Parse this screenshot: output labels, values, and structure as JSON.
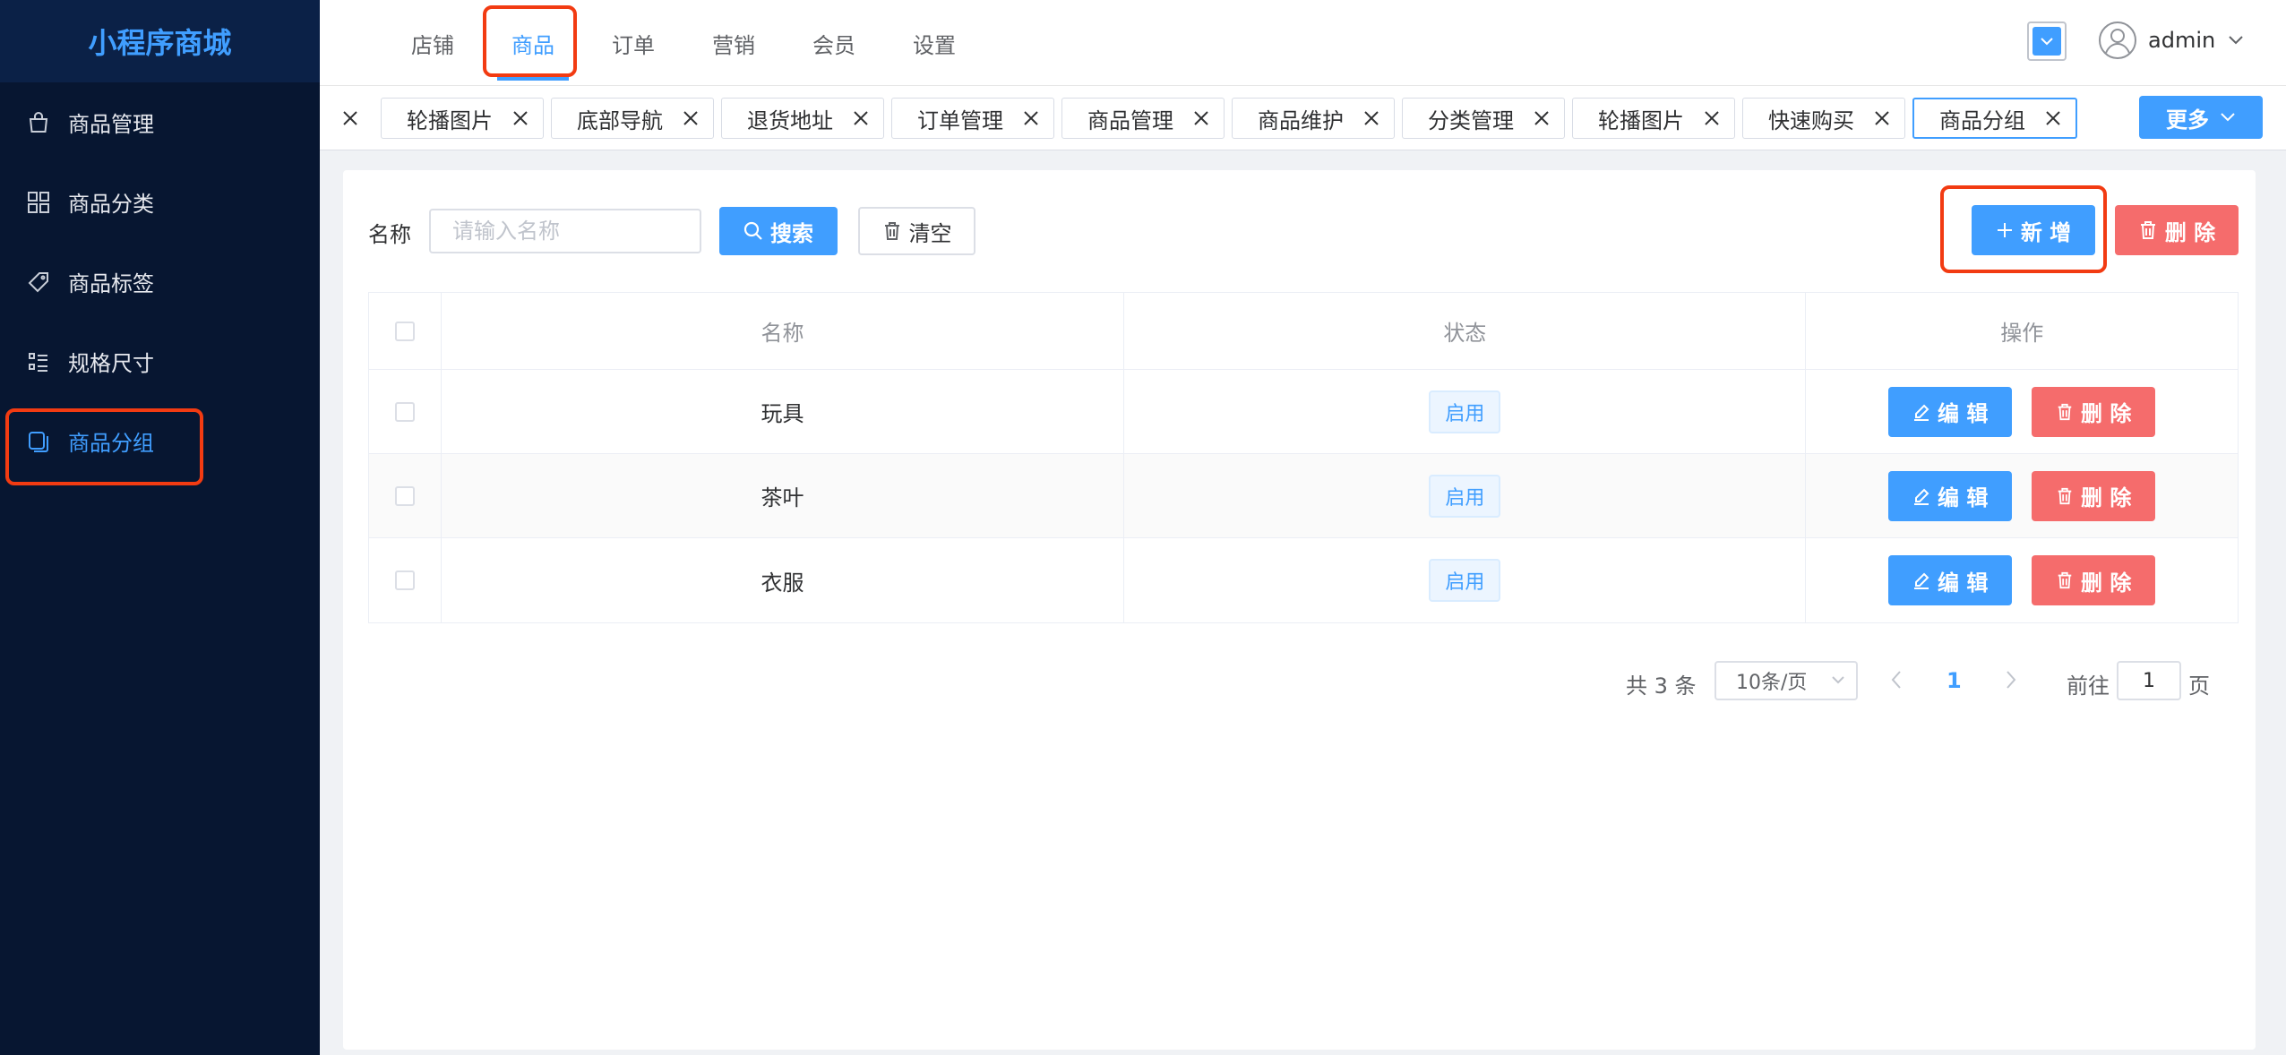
{
  "app": {
    "title": "小程序商城"
  },
  "sidebar": {
    "items": [
      {
        "label": "商品管理",
        "icon": "shopping-bag-icon"
      },
      {
        "label": "商品分类",
        "icon": "grid-icon"
      },
      {
        "label": "商品标签",
        "icon": "tag-icon"
      },
      {
        "label": "规格尺寸",
        "icon": "list-icon"
      },
      {
        "label": "商品分组",
        "icon": "copy-icon",
        "active": true
      }
    ]
  },
  "top_nav": {
    "items": [
      "店铺",
      "商品",
      "订单",
      "营销",
      "会员",
      "设置"
    ],
    "active": "商品"
  },
  "user": {
    "name": "admin"
  },
  "tags": {
    "items": [
      "轮播图片",
      "底部导航",
      "退货地址",
      "订单管理",
      "商品管理",
      "商品维护",
      "分类管理",
      "轮播图片",
      "快速购买",
      "商品分组"
    ],
    "active": "商品分组",
    "more_label": "更多"
  },
  "search": {
    "label": "名称",
    "placeholder": "请输入名称",
    "search_label": "搜索",
    "clear_label": "清空"
  },
  "toolbar": {
    "add_label": "新 增",
    "delete_label": "删 除"
  },
  "table": {
    "columns": [
      "名称",
      "状态",
      "操作"
    ],
    "rows": [
      {
        "name": "玩具",
        "status": "启用"
      },
      {
        "name": "茶叶",
        "status": "启用"
      },
      {
        "name": "衣服",
        "status": "启用"
      }
    ],
    "edit_label": "编 辑",
    "delete_label": "删 除"
  },
  "pagination": {
    "total": "共 3 条",
    "page_size": "10条/页",
    "current": "1",
    "goto_label": "前往",
    "goto_value": "1",
    "page_suffix": "页"
  },
  "colors": {
    "primary": "#409eff",
    "danger": "#f56c6c",
    "sidebar_bg": "#071631",
    "highlight": "#f23b12"
  }
}
